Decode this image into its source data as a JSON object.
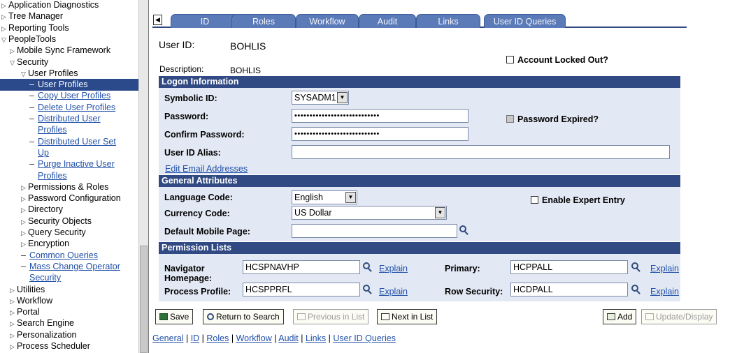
{
  "nav": {
    "items": [
      {
        "label": "Application Diagnostics",
        "indent": 0,
        "kind": "collapsed"
      },
      {
        "label": "Tree Manager",
        "indent": 0,
        "kind": "collapsed"
      },
      {
        "label": "Reporting Tools",
        "indent": 0,
        "kind": "collapsed"
      },
      {
        "label": "PeopleTools",
        "indent": 0,
        "kind": "expanded"
      },
      {
        "label": "Mobile Sync Framework",
        "indent": 1,
        "kind": "collapsed"
      },
      {
        "label": "Security",
        "indent": 1,
        "kind": "expanded"
      },
      {
        "label": "User Profiles",
        "indent": 2,
        "kind": "expanded"
      },
      {
        "label": "User Profiles",
        "indent": 3,
        "kind": "selected"
      },
      {
        "label": "Copy User Profiles",
        "indent": 3,
        "kind": "link"
      },
      {
        "label": "Delete User Profiles",
        "indent": 3,
        "kind": "link"
      },
      {
        "label": "Distributed User",
        "indent": 3,
        "kind": "link"
      },
      {
        "label": "Profiles",
        "indent": 3,
        "kind": "link-cont"
      },
      {
        "label": "Distributed User Set",
        "indent": 3,
        "kind": "link"
      },
      {
        "label": "Up",
        "indent": 3,
        "kind": "link-cont"
      },
      {
        "label": "Purge Inactive User",
        "indent": 3,
        "kind": "link"
      },
      {
        "label": "Profiles",
        "indent": 3,
        "kind": "link-cont"
      },
      {
        "label": "Permissions & Roles",
        "indent": 2,
        "kind": "collapsed"
      },
      {
        "label": "Password Configuration",
        "indent": 2,
        "kind": "collapsed"
      },
      {
        "label": "Directory",
        "indent": 2,
        "kind": "collapsed"
      },
      {
        "label": "Security Objects",
        "indent": 2,
        "kind": "collapsed"
      },
      {
        "label": "Query Security",
        "indent": 2,
        "kind": "collapsed"
      },
      {
        "label": "Encryption",
        "indent": 2,
        "kind": "collapsed"
      },
      {
        "label": "Common Queries",
        "indent": 2,
        "kind": "link"
      },
      {
        "label": "Mass Change Operator",
        "indent": 2,
        "kind": "link"
      },
      {
        "label": "Security",
        "indent": 2,
        "kind": "link-cont"
      },
      {
        "label": "Utilities",
        "indent": 1,
        "kind": "collapsed"
      },
      {
        "label": "Workflow",
        "indent": 1,
        "kind": "collapsed"
      },
      {
        "label": "Portal",
        "indent": 1,
        "kind": "collapsed"
      },
      {
        "label": "Search Engine",
        "indent": 1,
        "kind": "collapsed"
      },
      {
        "label": "Personalization",
        "indent": 1,
        "kind": "collapsed"
      },
      {
        "label": "Process Scheduler",
        "indent": 1,
        "kind": "collapsed"
      }
    ]
  },
  "tabs": [
    "ID",
    "Roles",
    "Workflow",
    "Audit",
    "Links",
    "User ID Queries"
  ],
  "header": {
    "user_id_label": "User ID:",
    "user_id_value": "BOHLIS",
    "description_label": "Description:",
    "description_value": "BOHLIS",
    "account_locked_label": "Account Locked Out?"
  },
  "logon": {
    "section_title": "Logon Information",
    "symbolic_id_label": "Symbolic ID:",
    "symbolic_id_value": "SYSADM1",
    "password_label": "Password:",
    "password_value": "••••••••••••••••••••••••••••",
    "confirm_password_label": "Confirm Password:",
    "confirm_password_value": "••••••••••••••••••••••••••••",
    "password_expired_label": "Password Expired?",
    "user_id_alias_label": "User ID Alias:",
    "user_id_alias_value": "",
    "edit_email_link": "Edit Email Addresses"
  },
  "general": {
    "section_title": "General Attributes",
    "language_code_label": "Language Code:",
    "language_code_value": "English",
    "currency_code_label": "Currency Code:",
    "currency_code_value": "US Dollar",
    "default_mobile_page_label": "Default Mobile Page:",
    "default_mobile_page_value": "",
    "enable_expert_entry_label": "Enable Expert Entry"
  },
  "permissions": {
    "section_title": "Permission Lists",
    "navigator_homepage_label_1": "Navigator",
    "navigator_homepage_label_2": "Homepage:",
    "navigator_homepage_value": "HCSPNAVHP",
    "process_profile_label": "Process Profile:",
    "process_profile_value": "HCSPPRFL",
    "primary_label": "Primary:",
    "primary_value": "HCPPALL",
    "row_security_label": "Row Security:",
    "row_security_value": "HCDPALL",
    "explain_label": "Explain"
  },
  "buttons": {
    "save": "Save",
    "return_to_search": "Return to Search",
    "previous_in_list": "Previous in List",
    "next_in_list": "Next in List",
    "add": "Add",
    "update_display": "Update/Display"
  },
  "footer_links": [
    "General",
    "ID",
    "Roles",
    "Workflow",
    "Audit",
    "Links",
    "User ID Queries"
  ],
  "colors": {
    "section_bar": "#314a83",
    "tab": "#5a7ab8",
    "nav_selected": "#2a4a8c",
    "link": "#1f4fa8"
  }
}
